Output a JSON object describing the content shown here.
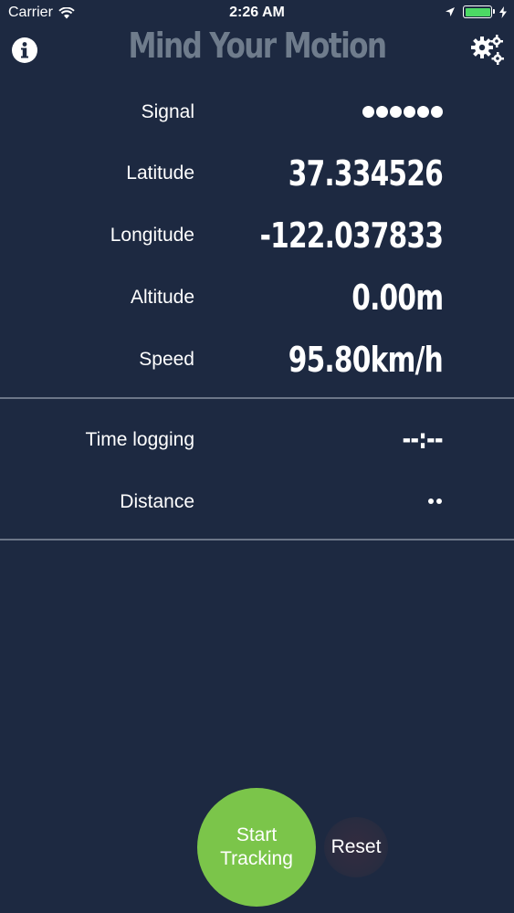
{
  "status_bar": {
    "carrier": "Carrier",
    "time": "2:26 AM",
    "battery_color": "#4cd964"
  },
  "header": {
    "title": "Mind Your Motion",
    "left_icon": "info-icon",
    "right_icon": "gears-icon",
    "title_color": "#6f7c8c"
  },
  "location": {
    "signal": {
      "label": "Signal",
      "bars": 6
    },
    "latitude": {
      "label": "Latitude",
      "value": "37.334526"
    },
    "longitude": {
      "label": "Longitude",
      "value": "-122.037833"
    },
    "altitude": {
      "label": "Altitude",
      "value": "0.00m"
    },
    "speed": {
      "label": "Speed",
      "value": "95.80km/h"
    }
  },
  "logging": {
    "time": {
      "label": "Time logging",
      "value": "--:--"
    },
    "distance": {
      "label": "Distance"
    }
  },
  "actions": {
    "start_line1": "Start",
    "start_line2": "Tracking",
    "reset": "Reset",
    "start_color": "#7bc54a"
  },
  "colors": {
    "background": "#1d2941",
    "divider": "#6c7688"
  }
}
